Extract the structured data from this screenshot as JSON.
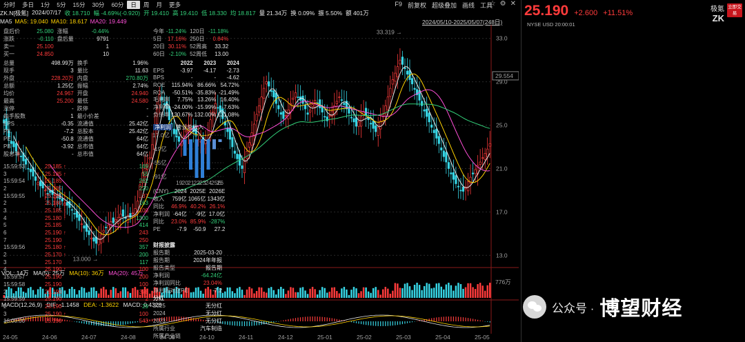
{
  "toolbar": {
    "periods": [
      "分时",
      "多日",
      "1分",
      "5分",
      "15分",
      "30分",
      "60分",
      "日",
      "周",
      "月",
      "更多"
    ],
    "active_period": "日",
    "right_items": [
      "F9",
      "前复权",
      "超级叠加",
      "画线",
      "工具"
    ],
    "icons": [
      "star-icon",
      "settings-icon",
      "close-icon"
    ]
  },
  "info": {
    "code": "ZK.N[极氪]",
    "date": "2024/07/17",
    "close": "收 18.710",
    "change": "幅 -4.69%(-0.920)",
    "open": "开 19.410",
    "high": "高 19.410",
    "low": "低 18.330",
    "avg": "均 18.817",
    "volume": "量 21.34万",
    "turnover": "换 0.09%",
    "amplitude": "振 5.50%",
    "amount": "额 401万"
  },
  "ma": {
    "ma5": "MA5: 19.040",
    "ma10": "MA10: 18.617",
    "ma20": "MA20: 19.449"
  },
  "range_label": "2024/05/10-2025/05/07(248日)",
  "volume_label": {
    "vol": "VOL: 14万",
    "ma5": "MA(5): 25万",
    "ma10": "MA(10): 36万",
    "ma20": "MA(20): 45万"
  },
  "macd_label": {
    "title": "MACD(12,26,9)",
    "dif": "DIF: -1.1458",
    "dea": "DEA: -1.3622",
    "macd": "MACD: 0.4328"
  },
  "chart_data": {
    "type": "candlestick",
    "y_ticks": [
      "33.0",
      "29.0",
      "25.0",
      "21.0",
      "17.0",
      "13.0"
    ],
    "current_price_label": "29.554",
    "high_annotation": "33.319",
    "low_annotation": "13.000",
    "volume_scale_label": "776万",
    "x_dates": [
      "24-05",
      "24-06",
      "24-07",
      "24-08",
      "24-09",
      "24-10",
      "24-11",
      "24-12",
      "25-01",
      "25-02",
      "25-03",
      "25-04",
      "25-05"
    ],
    "ylim": [
      12,
      34
    ],
    "close": [
      25.2,
      24.6,
      23.9,
      23.3,
      23.0,
      22.6,
      22.4,
      22.1,
      21.7,
      21.4,
      21.0,
      20.7,
      20.3,
      19.9,
      19.7,
      19.4,
      19.2,
      19.0,
      18.7,
      18.8,
      18.6,
      18.5,
      18.3,
      18.2,
      18.0,
      17.8,
      17.6,
      17.4,
      17.2,
      16.8,
      16.5,
      16.2,
      15.9,
      15.5,
      15.2,
      14.9,
      14.6,
      14.3,
      14.1,
      14.5,
      14.9,
      15.3,
      15.6,
      15.8,
      16.1,
      16.0,
      16.3,
      16.5,
      16.8,
      16.6,
      16.4,
      16.7,
      16.5,
      16.9,
      17.3,
      18.0,
      19.5,
      20.6,
      21.0,
      21.5,
      22.0,
      23.2,
      25.0,
      26.5,
      27.8,
      27.3,
      26.9,
      26.5,
      25.5,
      24.8,
      24.2,
      23.9,
      23.5,
      23.2,
      24.0,
      24.5,
      25.0,
      24.7,
      24.4,
      24.0,
      23.7,
      23.5,
      23.2,
      23.6,
      24.1,
      25.5,
      26.2,
      27.0,
      26.6,
      26.2,
      25.6,
      25.0,
      24.4,
      23.7,
      23.0,
      22.4,
      21.9,
      21.3,
      21.0,
      21.8,
      22.6,
      23.4,
      24.3,
      25.1,
      26.0,
      26.8,
      27.6,
      28.4,
      29.0,
      28.6,
      28.1,
      27.6,
      27.0,
      26.5,
      26.0,
      25.6,
      25.9,
      26.4,
      27.0,
      27.5,
      28.0,
      27.6,
      27.3,
      27.0,
      26.5,
      26.0,
      26.4,
      26.9,
      27.3,
      27.0,
      26.6,
      26.2,
      25.8,
      25.4,
      25.9,
      26.3,
      26.8,
      27.2,
      27.6,
      27.3,
      26.9,
      26.5,
      26.1,
      25.7,
      25.3,
      24.9,
      25.3,
      25.8,
      26.2,
      25.9,
      25.5,
      25.1,
      24.7,
      24.4,
      24.8,
      25.4,
      26.0,
      26.8,
      27.6,
      28.4,
      29.2,
      29.8,
      30.4,
      31.0,
      30.6,
      30.2,
      29.7,
      29.2,
      28.8,
      28.3,
      27.8,
      27.3,
      26.8,
      26.3,
      25.8,
      25.3,
      24.8,
      24.3,
      23.8,
      23.3,
      22.7,
      22.1,
      21.6,
      21.0,
      20.5,
      20.0,
      19.6,
      19.3,
      19.0,
      18.9,
      19.3,
      19.8,
      20.2,
      20.5,
      20.9,
      21.3,
      21.6,
      22.0,
      22.4,
      22.8,
      23.3
    ]
  },
  "quote": {
    "last": "25.190",
    "change": "+2.600",
    "pct": "+11.51%",
    "name": "极氪",
    "code": "ZK",
    "trade_btn": "立即交易",
    "market_line": "NYSE USD   20:00:01",
    "orderbook": [
      {
        "l": "盘后价",
        "v": "25.080",
        "c": "green",
        "l2": "涨幅",
        "v2": "-0.44%",
        "c2": "green"
      },
      {
        "l": "涨跌",
        "v": "-0.110",
        "c": "green",
        "l2": "盘后量",
        "v2": "9791",
        "c2": "white"
      },
      {
        "l": "卖一",
        "v": "25.100",
        "c": "red",
        "l2": "",
        "v2": "1",
        "c2": "white"
      },
      {
        "l": "买一",
        "v": "24.850",
        "c": "red",
        "l2": "",
        "v2": "10",
        "c2": "white"
      }
    ],
    "stats": [
      {
        "l": "总量",
        "v": "498.99万",
        "c": "white",
        "l2": "换手",
        "v2": "1.96%",
        "c2": "white"
      },
      {
        "l": "现手",
        "v": "3",
        "c": "white",
        "l2": "量比",
        "v2": "11.63",
        "c2": "white"
      },
      {
        "l": "外盘",
        "v": "228.20万",
        "c": "red",
        "l2": "内盘",
        "v2": "270.80万",
        "c2": "green"
      },
      {
        "l": "总额",
        "v": "1.25亿",
        "c": "white",
        "l2": "振幅",
        "v2": "2.74%",
        "c2": "white"
      },
      {
        "l": "均价",
        "v": "24.967",
        "c": "red",
        "l2": "开盘",
        "v2": "24.940",
        "c2": "red"
      },
      {
        "l": "最高",
        "v": "25.200",
        "c": "red",
        "l2": "最低",
        "v2": "24.580",
        "c2": "red"
      },
      {
        "l": "涨停",
        "v": "-",
        "c": "white",
        "l2": "跌停",
        "v2": "-",
        "c2": "white"
      },
      {
        "l": "每手股数",
        "v": "1",
        "c": "white",
        "l2": "最小价差",
        "v2": "-",
        "c2": "white"
      },
      {
        "l": "EPS",
        "v": "-0.35",
        "c": "white",
        "l2": "流通值",
        "v2": "25.42亿",
        "c2": "white"
      },
      {
        "l": "PE",
        "v": "-7.2",
        "c": "white",
        "l2": "总股本",
        "v2": "25.42亿",
        "c2": "white"
      },
      {
        "l": "PE",
        "v": "-50.8",
        "c": "white",
        "l2": "流通值",
        "v2": "64亿",
        "c2": "white"
      },
      {
        "l": "PB",
        "v": "-3.92",
        "c": "white",
        "l2": "总市值",
        "v2": "64亿",
        "c2": "white"
      },
      {
        "l": "股息率",
        "v": "-",
        "c": "white",
        "l2": "总市值",
        "v2": "64亿",
        "c2": "white"
      }
    ],
    "ticks": [
      {
        "t": "15:59:53",
        "p": "25.185",
        "a": "up",
        "v": "169",
        "c": "green"
      },
      {
        "t": "3",
        "p": "25.185",
        "a": "up",
        "v": "55",
        "c": "green"
      },
      {
        "t": "15:59:54",
        "p": "25.185",
        "a": "",
        "v": "262",
        "c": "green"
      },
      {
        "t": "2",
        "p": "25.185",
        "a": "",
        "v": "220",
        "c": "green"
      },
      {
        "t": "15:59:55",
        "p": "25.185",
        "a": "",
        "v": "37",
        "c": "red"
      },
      {
        "t": "2",
        "p": "25.180",
        "a": "up",
        "v": "163",
        "c": "green"
      },
      {
        "t": "3",
        "p": "25.185",
        "a": "up",
        "v": "100",
        "c": "red"
      },
      {
        "t": "4",
        "p": "25.180",
        "a": "up",
        "v": "1300",
        "c": "green"
      },
      {
        "t": "5",
        "p": "25.185",
        "a": "",
        "v": "414",
        "c": "green"
      },
      {
        "t": "6",
        "p": "25.190",
        "a": "up",
        "v": "243",
        "c": "red"
      },
      {
        "t": "7",
        "p": "25.190",
        "a": "",
        "v": "250",
        "c": "red"
      },
      {
        "t": "15:59:56",
        "p": "25.180",
        "a": "up",
        "v": "357",
        "c": "green"
      },
      {
        "t": "2",
        "p": "25.170",
        "a": "up",
        "v": "200",
        "c": "green"
      },
      {
        "t": "3",
        "p": "25.170",
        "a": "",
        "v": "117",
        "c": "green"
      },
      {
        "t": "4",
        "p": "25.190",
        "a": "up",
        "v": "100",
        "c": "red"
      },
      {
        "t": "15:59:57",
        "p": "25.190",
        "a": "",
        "v": "200",
        "c": "red"
      },
      {
        "t": "15:59:58",
        "p": "25.190",
        "a": "",
        "v": "100",
        "c": "red"
      },
      {
        "t": "2",
        "p": "25.190",
        "a": "",
        "v": "378",
        "c": "red"
      },
      {
        "t": "15:59:59",
        "p": "25.190",
        "a": "",
        "v": "2",
        "c": "red"
      },
      {
        "t": "2",
        "p": "25.190",
        "a": "",
        "v": "29",
        "c": "green"
      },
      {
        "t": "3",
        "p": "25.190",
        "a": "up",
        "v": "100",
        "c": "red"
      },
      {
        "t": "16:00:00",
        "p": "25.190",
        "a": "",
        "v": "543",
        "c": "red"
      }
    ],
    "perf": [
      {
        "l": "今年",
        "v": "-11.24%",
        "c": "green",
        "l2": "120日",
        "v2": "-11.18%",
        "c2": "green"
      },
      {
        "l": "5日",
        "v": "17.16%",
        "c": "red",
        "l2": "250日",
        "v2": "0.84%",
        "c2": "red"
      },
      {
        "l": "20日",
        "v": "30.11%",
        "c": "red",
        "l2": "52周高",
        "v2": "33.32",
        "c2": "white"
      },
      {
        "l": "60日",
        "v": "-2.10%",
        "c": "green",
        "l2": "52周低",
        "v2": "13.00",
        "c2": "white"
      }
    ],
    "fin_years": [
      "2022",
      "2023",
      "2024"
    ],
    "fin": [
      {
        "l": "EPS",
        "v": [
          "-3.97",
          "-4.17",
          "-2.73"
        ],
        "c": [
          "white",
          "white",
          "white"
        ]
      },
      {
        "l": "BPS",
        "v": [
          "-",
          "-",
          "-4.62"
        ],
        "c": [
          "white",
          "white",
          "white"
        ]
      },
      {
        "l": "ROE",
        "v": [
          "115.94%",
          "86.66%",
          "54.72%"
        ],
        "c": [
          "white",
          "white",
          "white"
        ]
      },
      {
        "l": "ROA",
        "v": [
          "-50.51%",
          "-35.83%",
          "-21.49%"
        ],
        "c": [
          "white",
          "white",
          "white"
        ]
      },
      {
        "l": "毛利率",
        "v": [
          "7.75%",
          "13.26%",
          "16.40%"
        ],
        "c": [
          "white",
          "white",
          "white"
        ]
      },
      {
        "l": "净利率",
        "v": [
          "-24.00%",
          "-15.99%",
          "-7.63%"
        ],
        "c": [
          "white",
          "white",
          "white"
        ]
      },
      {
        "l": "负债率",
        "v": [
          "130.67%",
          "132.00%",
          "131.08%"
        ],
        "c": [
          "white",
          "white",
          "white"
        ]
      }
    ],
    "rev_tag": "净利润",
    "rev_label": "营业总收入",
    "rev_chart": {
      "y_labels": [
        "17.0亿",
        "-19亿",
        "-55亿",
        "-91亿"
      ],
      "x_labels": [
        "19",
        "20",
        "21",
        "22",
        "23",
        "24",
        "25E",
        "26E"
      ],
      "values": [
        0,
        -30,
        -55,
        -70,
        -70,
        -55,
        -18,
        -5
      ]
    },
    "proj_head": [
      "(CNY)",
      "2024",
      "2025E",
      "2026E"
    ],
    "proj": [
      {
        "l": "收入",
        "v": [
          "759亿",
          "1065亿",
          "1343亿"
        ],
        "c": [
          "white",
          "white",
          "white"
        ]
      },
      {
        "l": "同比",
        "v": [
          "46.9%",
          "40.2%",
          "26.1%"
        ],
        "c": [
          "red",
          "red",
          "red"
        ]
      },
      {
        "l": "净利润",
        "v": [
          "-64亿",
          "-9亿",
          "17.0亿"
        ],
        "c": [
          "white",
          "white",
          "white"
        ]
      },
      {
        "l": "同比",
        "v": [
          "23.0%",
          "85.9%",
          "-287%"
        ],
        "c": [
          "red",
          "red",
          "green"
        ]
      },
      {
        "l": "PE",
        "v": [
          "-7.9",
          "-50.9",
          "27.2"
        ],
        "c": [
          "white",
          "white",
          "white"
        ]
      }
    ],
    "report": [
      {
        "l": "财报披露",
        "v": "",
        "sec": true
      },
      {
        "l": "报告期",
        "v": "2025-03-20"
      },
      {
        "l": "报告期",
        "v": "2024年年报"
      },
      {
        "l": "报告类型",
        "v": "报告期"
      },
      {
        "l": "净利润",
        "v": "-64.24亿",
        "c": "green"
      },
      {
        "l": "净利润同比",
        "v": "23.04%",
        "c": "red"
      },
      {
        "l": "净利润对应PE",
        "v": "-7.2"
      },
      {
        "l": "分红",
        "v": "",
        "sec": true
      },
      {
        "l": "2025",
        "v": "无分红"
      },
      {
        "l": "2024",
        "v": "无分红"
      },
      {
        "l": "2023",
        "v": "无分红"
      },
      {
        "l": "所属行业",
        "v": "汽车制造"
      },
      {
        "l": "所属产业链",
        "v": ""
      }
    ]
  },
  "watermark": {
    "sub": "公众号 ·",
    "main": "博望财经"
  }
}
